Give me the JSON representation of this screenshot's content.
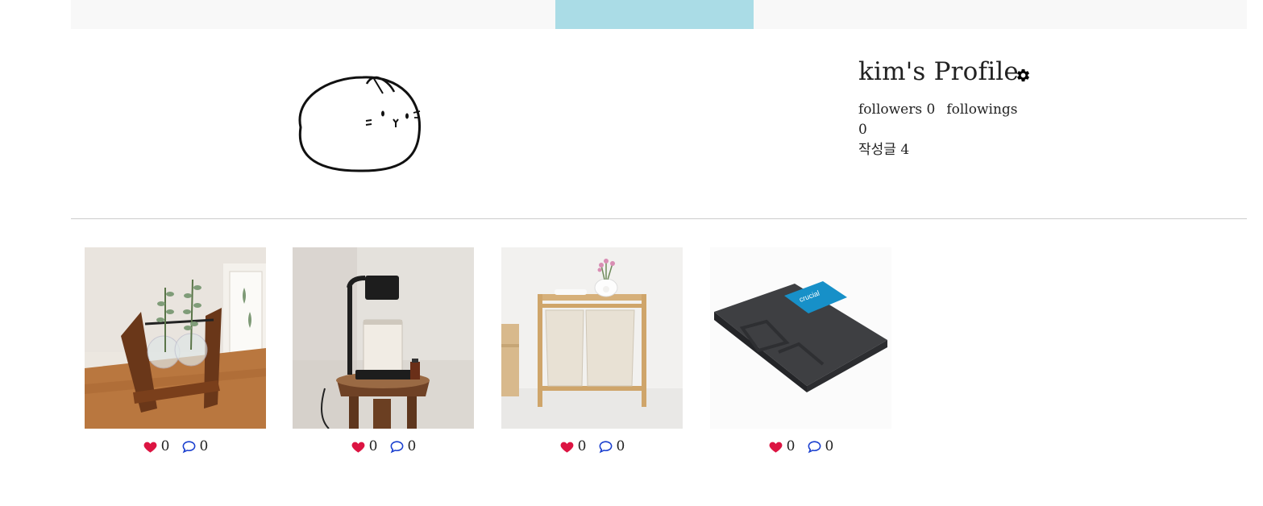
{
  "profile": {
    "title": "kim's Profile",
    "followers_label": "followers",
    "followers_count": "0",
    "followings_label": "followings",
    "followings_count": "0",
    "posts_label": "작성글",
    "posts_count": "4",
    "settings_icon": "gear-icon",
    "avatar": "cartoon-bunny-avatar"
  },
  "nav": {
    "active_tab_color": "#aadce6",
    "bar_color": "#f8f8f8"
  },
  "posts": [
    {
      "image": "wooden-plant-vase-stand",
      "likes": "0",
      "comments": "0"
    },
    {
      "image": "candle-warmer-lamp",
      "likes": "0",
      "comments": "0"
    },
    {
      "image": "bamboo-laundry-hamper",
      "likes": "0",
      "comments": "0"
    },
    {
      "image": "crucial-ssd-drive",
      "likes": "0",
      "comments": "0"
    }
  ],
  "colors": {
    "like": "#dc1442",
    "comment": "#1a3fcf"
  }
}
